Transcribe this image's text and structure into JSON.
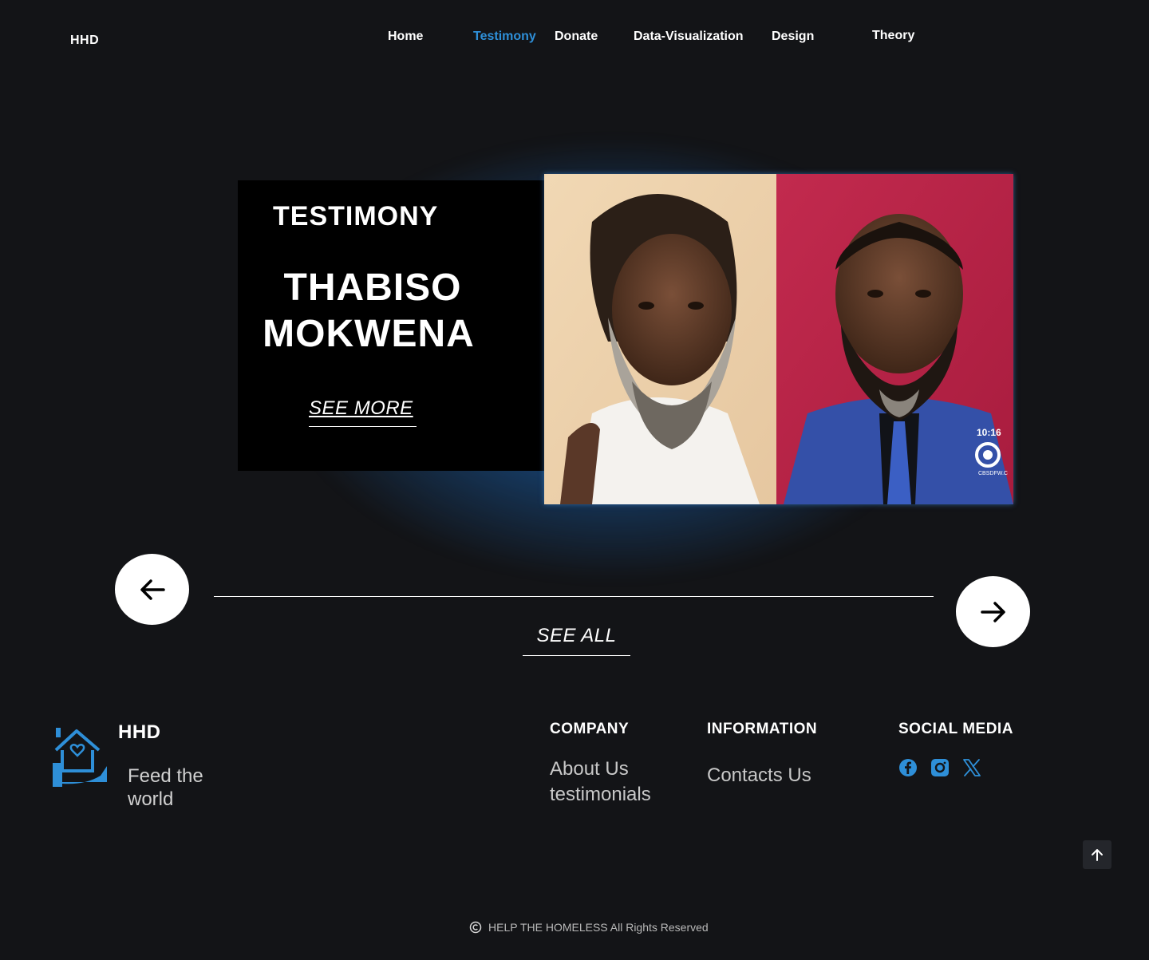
{
  "header": {
    "brand": "HHD",
    "nav": [
      {
        "label": "Home",
        "active": false
      },
      {
        "label": "Testimony",
        "active": true
      },
      {
        "label": "Donate",
        "active": false
      },
      {
        "label": "Data-Visualization",
        "active": false
      },
      {
        "label": "Design",
        "active": false
      },
      {
        "label": "Theory",
        "active": false
      }
    ]
  },
  "hero": {
    "label": "TESTIMONY",
    "name_line1": "THABISO",
    "name_line2": "MOKWENA",
    "see_more": "SEE MORE",
    "photo": {
      "overlay_time": "10:16",
      "overlay_channel": "CBSDFW.C"
    }
  },
  "carousel": {
    "prev_icon": "arrow-left-icon",
    "next_icon": "arrow-right-icon",
    "see_all": "SEE ALL"
  },
  "footer": {
    "brand": "HHD",
    "tagline": "Feed the world",
    "company": {
      "heading": "COMPANY",
      "links": [
        "About Us",
        "testimonials"
      ]
    },
    "information": {
      "heading": "INFORMATION",
      "links": [
        "Contacts Us"
      ]
    },
    "social": {
      "heading": "SOCIAL MEDIA",
      "icons": [
        "facebook-icon",
        "instagram-icon",
        "x-icon"
      ]
    },
    "copyright": "HELP THE HOMELESS All Rights Reserved"
  },
  "colors": {
    "background": "#131417",
    "accent": "#2e8fd8",
    "glow": "#1f6fb8"
  }
}
